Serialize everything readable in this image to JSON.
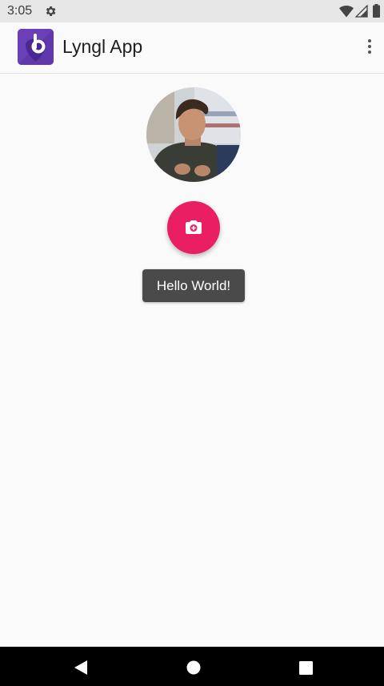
{
  "status_bar": {
    "time": "3:05",
    "icons": [
      "gear-icon",
      "wifi-icon",
      "signal-icon",
      "battery-icon"
    ]
  },
  "app_bar": {
    "title": "Lyngl App",
    "logo_icon": "lyngl-logo-icon",
    "menu_icon": "more-vert-icon"
  },
  "main": {
    "avatar": "profile-photo",
    "fab_icon": "add-a-photo-icon",
    "toast_text": "Hello World!"
  },
  "nav_bar": {
    "icons": [
      "back-icon",
      "home-icon",
      "recents-icon"
    ]
  },
  "colors": {
    "accent": "#e91e63",
    "brand": "#6b3fb8",
    "background": "#fafafa",
    "toast": "#4a4a4a"
  }
}
